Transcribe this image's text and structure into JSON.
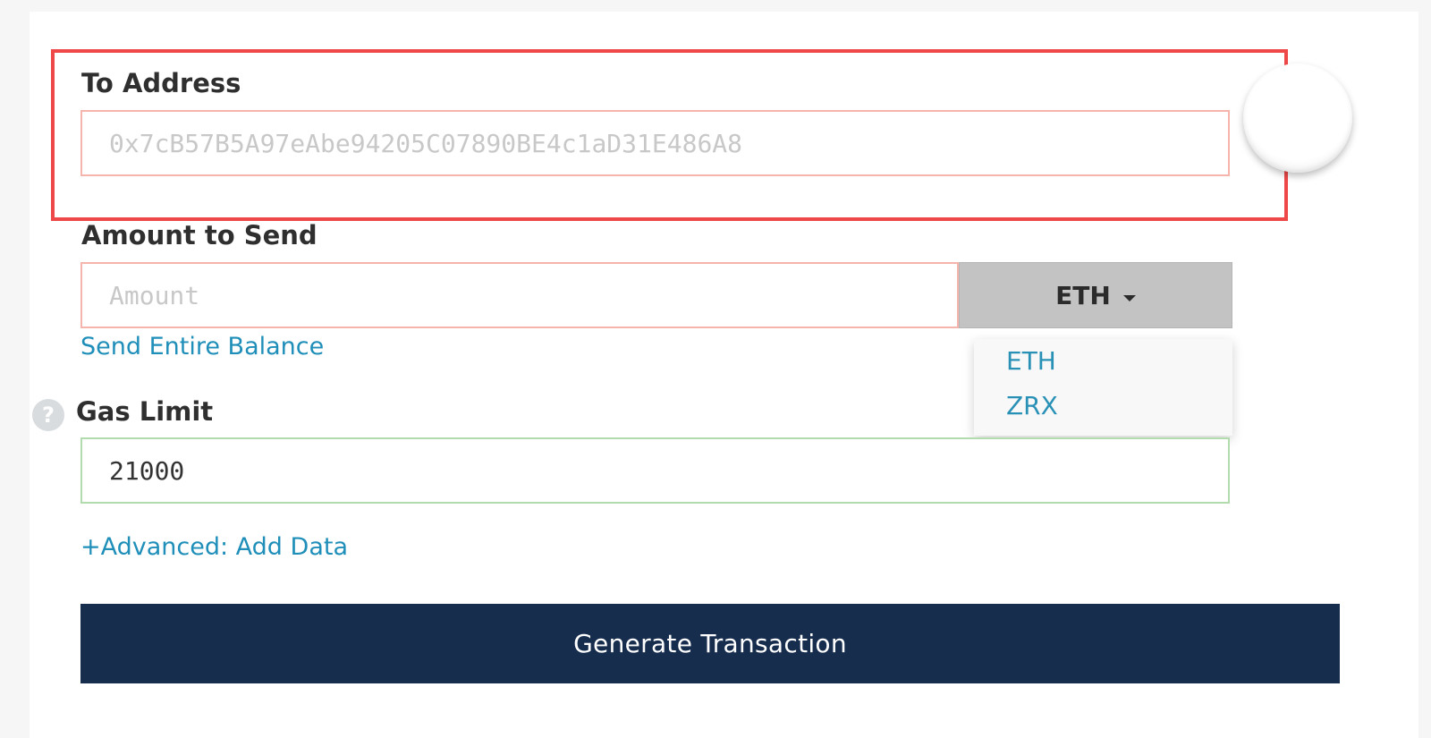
{
  "to_address": {
    "label": "To Address",
    "placeholder": "0x7cB57B5A97eAbe94205C07890BE4c1aD31E486A8",
    "value": ""
  },
  "amount": {
    "label": "Amount to Send",
    "placeholder": "Amount",
    "value": "",
    "currency_selected": "ETH",
    "currency_options": [
      "ETH",
      "ZRX"
    ],
    "send_entire_balance_link": "Send Entire Balance"
  },
  "gas_limit": {
    "label": "Gas Limit",
    "value": "21000",
    "help_icon": "question-mark-icon",
    "help_glyph": "?"
  },
  "advanced_link": "+Advanced: Add Data",
  "generate_button": "Generate Transaction",
  "colors": {
    "highlight_border": "#ef4848",
    "link": "#1f8fb9",
    "primary_button": "#172d4e",
    "invalid_input_border": "#f5b5ad",
    "valid_input_border": "#b2dcae",
    "currency_button": "#c3c3c3"
  }
}
